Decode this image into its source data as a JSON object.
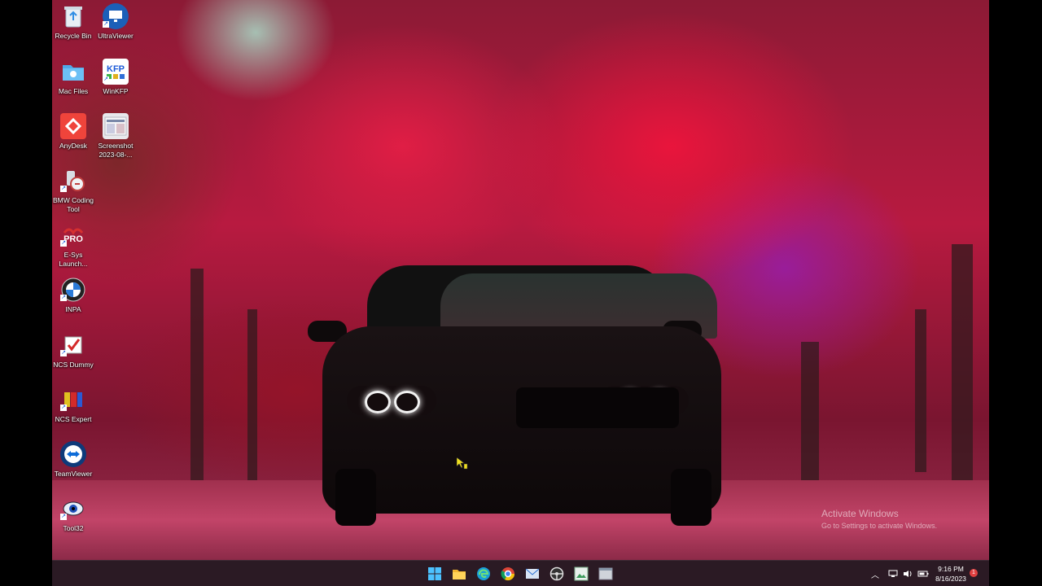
{
  "desktop": {
    "icons": [
      {
        "label": "Recycle Bin",
        "icon": "recycle-bin-icon"
      },
      {
        "label": "UltraViewer",
        "icon": "ultraviewer-icon"
      },
      {
        "label": "Mac Files",
        "icon": "folder-icon"
      },
      {
        "label": "WinKFP",
        "icon": "winkfp-icon"
      },
      {
        "label": "AnyDesk",
        "icon": "anydesk-icon"
      },
      {
        "label": "Screenshot\n2023-08-...",
        "icon": "image-file-icon"
      },
      {
        "label": "BMW Coding\nTool",
        "icon": "bmw-coding-tool-icon"
      },
      {
        "label": "E-Sys\nLaunch...",
        "icon": "esys-launcher-icon"
      },
      {
        "label": "INPA",
        "icon": "bmw-logo-icon"
      },
      {
        "label": "NCS Dummy",
        "icon": "ncs-dummy-icon"
      },
      {
        "label": "NCS Expert",
        "icon": "ncs-expert-icon"
      },
      {
        "label": "TeamViewer",
        "icon": "teamviewer-icon"
      },
      {
        "label": "Tool32",
        "icon": "tool32-icon"
      }
    ],
    "icon_badges": {
      "winkfp": "KFP",
      "esys": "PRO"
    }
  },
  "watermark": {
    "title": "Activate Windows",
    "subtitle": "Go to Settings to activate Windows."
  },
  "taskbar": {
    "apps": [
      "start-icon",
      "file-explorer-icon",
      "edge-icon",
      "chrome-icon",
      "mail-icon",
      "steering-wheel-app-icon",
      "image-viewer-icon",
      "app-window-icon"
    ],
    "clock": {
      "time": "9:16 PM",
      "date": "8/16/2023"
    },
    "notification_count": "1"
  },
  "colors": {
    "taskbar_bg": "#2b1a24",
    "windows_blue": "#1d9bf0",
    "anydesk_red": "#ef443b"
  }
}
